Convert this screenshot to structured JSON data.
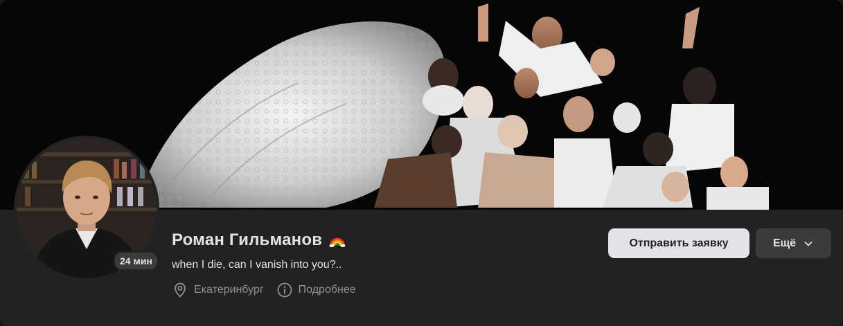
{
  "profile": {
    "name": "Роман Гильманов",
    "name_emoji": "🌈",
    "status": "when I die, can I vanish into you?..",
    "last_seen": "24 мин",
    "city": "Екатеринбург",
    "more_info_label": "Подробнее",
    "icons": {
      "city": "location-pin-icon",
      "details": "info-circle-icon",
      "more": "chevron-down-icon"
    }
  },
  "actions": {
    "friend_request_label": "Отправить заявку",
    "more_label": "Ещё"
  },
  "colors": {
    "panel_bg": "#222222",
    "text_primary": "#e1e3e6",
    "text_secondary": "#939393",
    "button_primary_bg": "#e1e3e6",
    "button_secondary_bg": "#3b3b3b"
  }
}
